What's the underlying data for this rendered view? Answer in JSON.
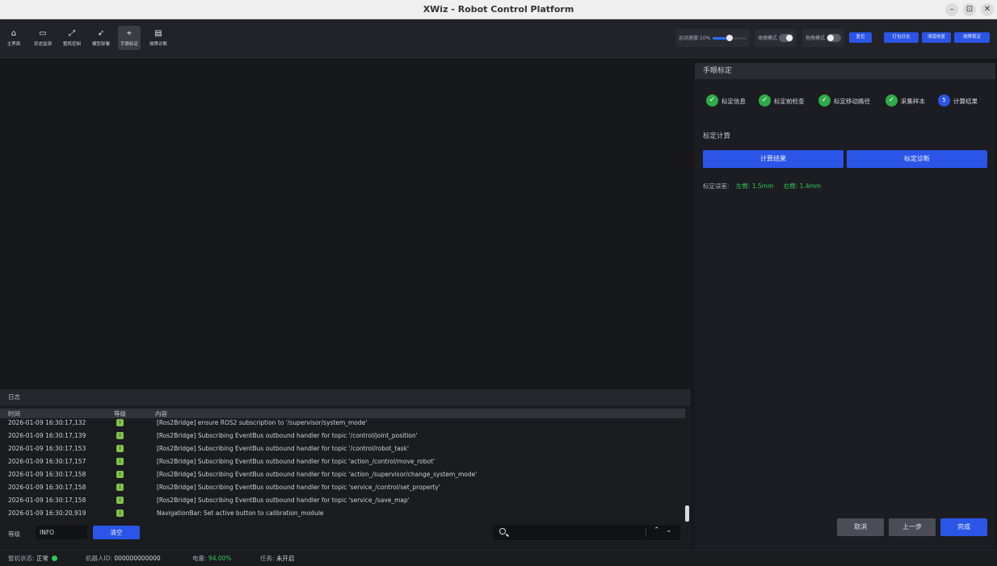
{
  "window": {
    "title": "XWiz - Robot Control Platform",
    "min": "–",
    "max": "⊡",
    "close": "✕"
  },
  "toolbar": {
    "nav": [
      {
        "label": "主界面",
        "icon": "⌂"
      },
      {
        "label": "状态监测",
        "icon": "▭"
      },
      {
        "label": "整机控制",
        "icon": "⤢"
      },
      {
        "label": "模型部署",
        "icon": "➶"
      },
      {
        "label": "手眼标定",
        "icon": "⌖"
      },
      {
        "label": "故障诊断",
        "icon": "▤"
      }
    ],
    "speed_label": "运动速度:10%",
    "speed_percent": 10,
    "follow_mode_label": "体随模式",
    "drag_mode_label": "拖拽模式",
    "reset_label": "复位",
    "pack_log_label": "打包日志",
    "clear_fault_label": "清错恢复",
    "fault_lock_label": "故障锁定"
  },
  "calibration": {
    "header": "手眼标定",
    "steps": [
      {
        "label": "标定信息",
        "mark": "✓"
      },
      {
        "label": "标定前检查",
        "mark": "✓"
      },
      {
        "label": "标定移动路径",
        "mark": "✓"
      },
      {
        "label": "采集样本",
        "mark": "✓"
      },
      {
        "label": "计算结果",
        "mark": "5"
      }
    ],
    "section_title": "标定计算",
    "compute_label": "计算结果",
    "diagnose_label": "标定诊断",
    "error_label": "标定误差:",
    "left_arm": "左臂: 1.5mm",
    "right_arm": "右臂: 1.4mm",
    "cancel_label": "取消",
    "prev_label": "上一步",
    "finish_label": "完成"
  },
  "log": {
    "title": "日志",
    "col_time": "时间",
    "col_level": "等级",
    "col_content": "内容",
    "level_badge": "I",
    "rows": [
      {
        "time": "2026-01-09 16:30:17,132",
        "msg": "[Ros2Bridge] ensure ROS2 subscription to '/supervisor/system_mode'"
      },
      {
        "time": "2026-01-09 16:30:17,139",
        "msg": "[Ros2Bridge] Subscribing EventBus outbound handler for topic '/control/joint_position'"
      },
      {
        "time": "2026-01-09 16:30:17,153",
        "msg": "[Ros2Bridge] Subscribing EventBus outbound handler for topic '/control/robot_task'"
      },
      {
        "time": "2026-01-09 16:30:17,157",
        "msg": "[Ros2Bridge] Subscribing EventBus outbound handler for topic 'action_/control/move_robot'"
      },
      {
        "time": "2026-01-09 16:30:17,158",
        "msg": "[Ros2Bridge] Subscribing EventBus outbound handler for topic 'action_/supervisor/change_system_mode'"
      },
      {
        "time": "2026-01-09 16:30:17,158",
        "msg": "[Ros2Bridge] Subscribing EventBus outbound handler for topic 'service_/control/set_property'"
      },
      {
        "time": "2026-01-09 16:30:17,158",
        "msg": "[Ros2Bridge] Subscribing EventBus outbound handler for topic 'service_/save_map'"
      },
      {
        "time": "2026-01-09 16:30:20,919",
        "msg": "NavigationBar: Set active button to calibration_module"
      }
    ],
    "level_label": "等级",
    "level_value": "INFO",
    "clear_label": "清空",
    "up_arrow": "⌃",
    "down_arrow": "⌄"
  },
  "status": {
    "machine_label": "整机状态:",
    "machine_value": "正常",
    "robot_id_label": "机器人ID:",
    "robot_id_value": "000000000000",
    "battery_label": "电量:",
    "battery_value": "94.00%",
    "task_label": "任务:",
    "task_value": "未开启"
  },
  "colors": {
    "accent": "#2b55e6",
    "ok": "#34c759",
    "bg": "#17181c"
  }
}
